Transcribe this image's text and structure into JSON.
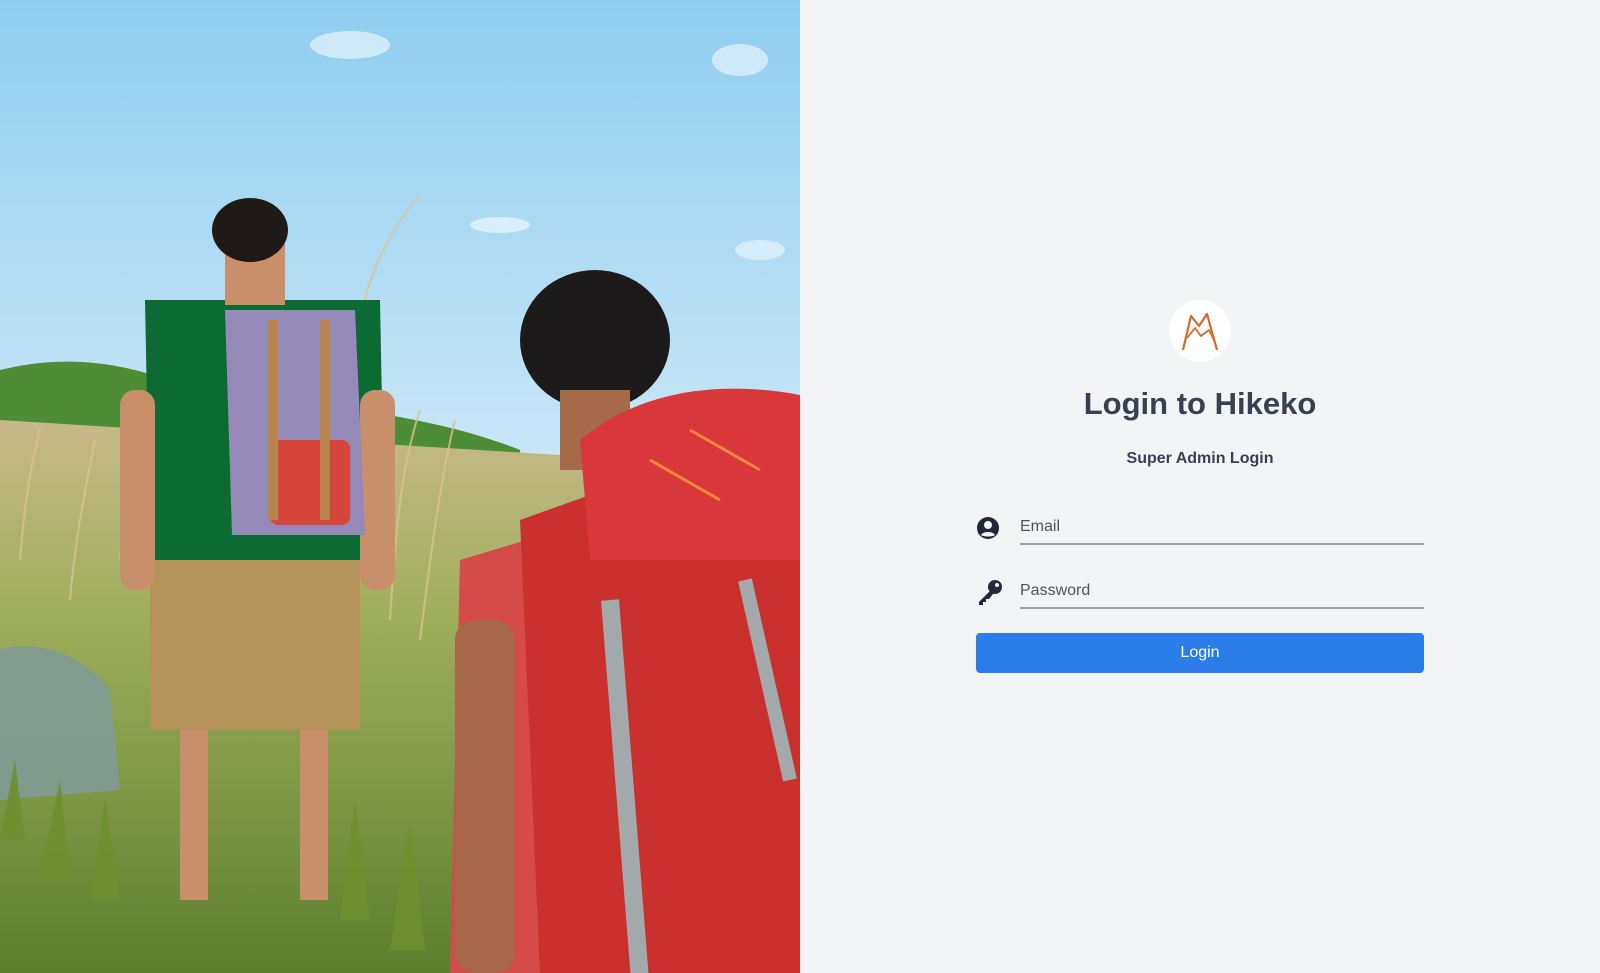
{
  "login": {
    "title": "Login to Hikeko",
    "subtitle": "Super Admin Login",
    "email_placeholder": "Email",
    "password_placeholder": "Password",
    "submit_label": "Login"
  },
  "icons": {
    "logo": "mountain-logo-icon",
    "email": "user-circle-icon",
    "password": "key-icon"
  },
  "colors": {
    "panel_background": "#f3f4f6",
    "heading_text": "#374151",
    "login_button": "#2b7de9",
    "logo_accent": "#d9662b",
    "input_underline": "#9ca3af"
  }
}
